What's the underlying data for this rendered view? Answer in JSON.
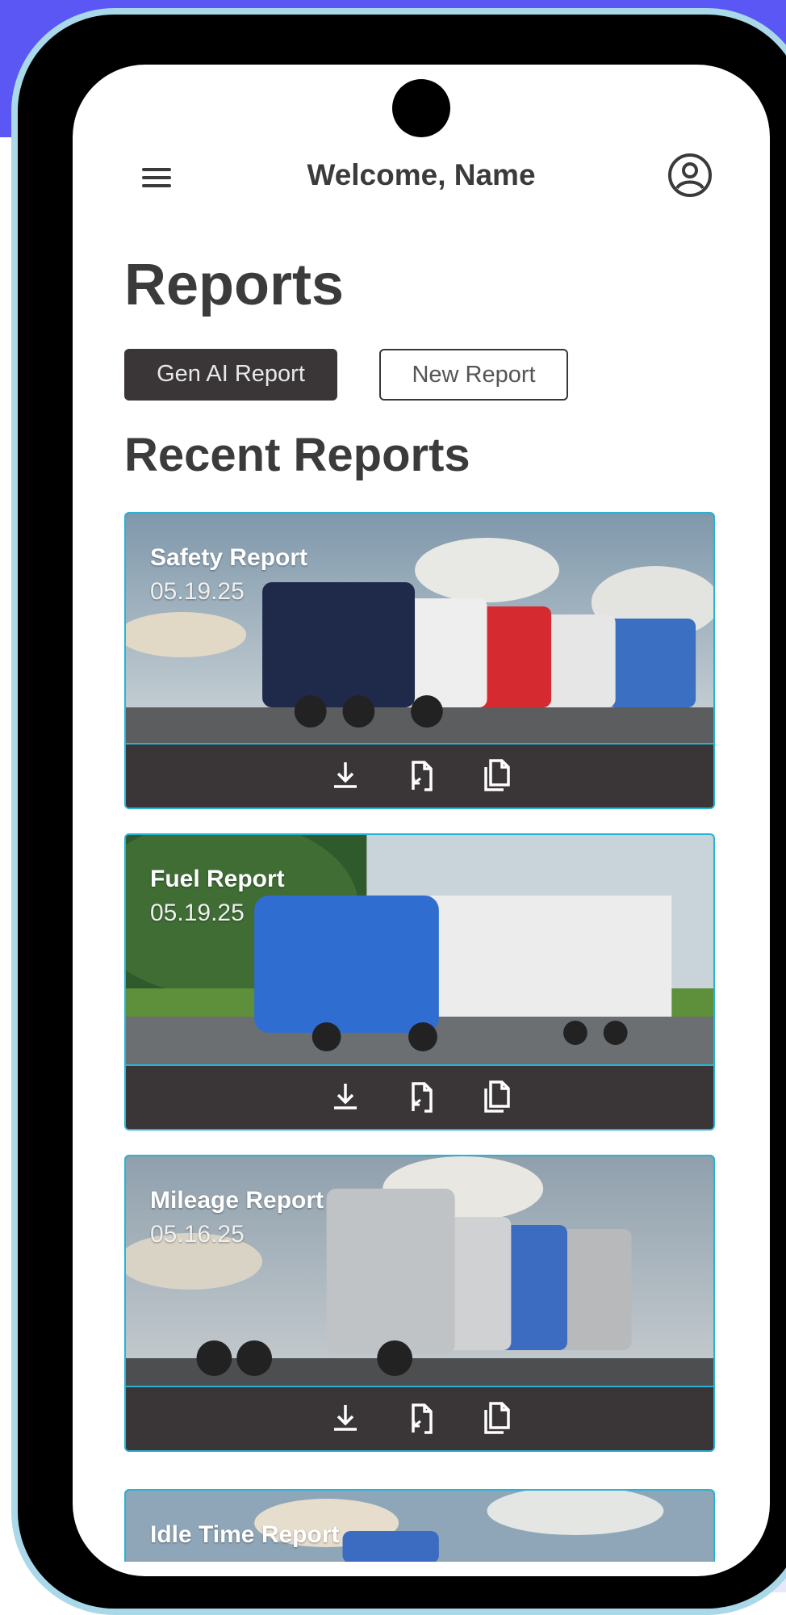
{
  "header": {
    "welcome": "Welcome, Name",
    "menu_icon": "hamburger-menu-icon",
    "account_icon": "user-account-icon"
  },
  "page": {
    "title": "Reports"
  },
  "buttons": {
    "gen_ai": "Gen AI Report",
    "new_report": "New Report"
  },
  "recent": {
    "title": "Recent Reports",
    "cards": [
      {
        "title": "Safety Report",
        "date": "05.19.25",
        "image": "row of multicolored semi trucks"
      },
      {
        "title": "Fuel Report",
        "date": "05.19.25",
        "image": "blue semi truck with trailer on road"
      },
      {
        "title": "Mileage Report",
        "date": "05.16.25",
        "image": "row of silver and blue semi trucks"
      },
      {
        "title": "Idle Time Report",
        "date": "",
        "image": "semi trucks under cloudy sky"
      }
    ],
    "card_actions": [
      "download-icon",
      "export-file-icon",
      "copy-icon"
    ]
  },
  "colors": {
    "accent_border": "#27b3d6",
    "dark_button": "#3a3536",
    "background_blue": "#5a57f5"
  }
}
